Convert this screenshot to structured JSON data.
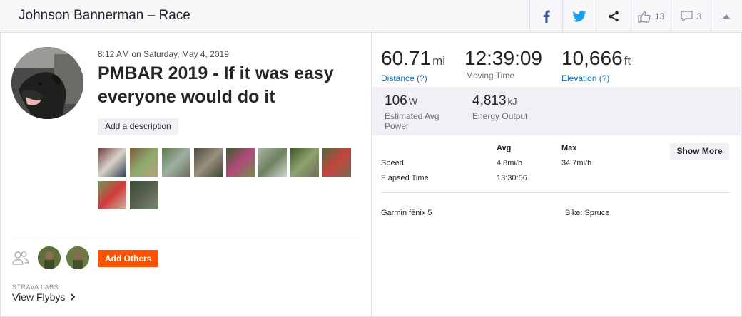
{
  "header": {
    "title": "Johnson Bannerman – Race",
    "kudos_count": "13",
    "comments_count": "3"
  },
  "activity": {
    "date": "8:12 AM on Saturday, May 4, 2019",
    "title": "PMBAR 2019 - If it was easy everyone would do it",
    "add_description": "Add a description"
  },
  "photos": [
    {
      "colors": [
        "#6b3f3a",
        "#d9d4c8",
        "#2f3f56"
      ]
    },
    {
      "colors": [
        "#7a5a3b",
        "#8eab6f",
        "#b6a27c"
      ]
    },
    {
      "colors": [
        "#5d7a4b",
        "#9fb0a4",
        "#6a6b57"
      ]
    },
    {
      "colors": [
        "#4a4b3b",
        "#9b8e80",
        "#3d4a33"
      ]
    },
    {
      "colors": [
        "#3e5b2d",
        "#b24a7a",
        "#6f8f4a"
      ]
    },
    {
      "colors": [
        "#a8b2a2",
        "#6e8262",
        "#cfd6cc"
      ]
    },
    {
      "colors": [
        "#3f5a2c",
        "#8ea26c",
        "#6a6f58"
      ]
    },
    {
      "colors": [
        "#4d6b3a",
        "#c4443c",
        "#7b6a52"
      ]
    },
    {
      "colors": [
        "#6d9a55",
        "#d03a3a",
        "#c8b3a0"
      ]
    },
    {
      "colors": [
        "#3b4a3a",
        "#59614f",
        "#7c8a6e"
      ]
    }
  ],
  "social": {
    "add_others": "Add Others",
    "labs_label": "STRAVA LABS",
    "flybys": "View Flybys"
  },
  "stats": {
    "distance": {
      "value": "60.71",
      "unit": "mi",
      "label": "Distance (?)"
    },
    "moving_time": {
      "value": "12:39:09",
      "label": "Moving Time"
    },
    "elevation": {
      "value": "10,666",
      "unit": "ft",
      "label": "Elevation (?)"
    },
    "power": {
      "value": "106",
      "unit": "W",
      "label": "Estimated Avg Power"
    },
    "energy": {
      "value": "4,813",
      "unit": "kJ",
      "label": "Energy Output"
    }
  },
  "table": {
    "col_avg": "Avg",
    "col_max": "Max",
    "show_more": "Show More",
    "rows": [
      {
        "label": "Speed",
        "avg": "4.8mi/h",
        "max": "34.7mi/h"
      },
      {
        "label": "Elapsed Time",
        "avg": "13:30:56",
        "max": ""
      }
    ]
  },
  "gear": {
    "device": "Garmin fēnix 5",
    "bike": "Bike: Spruce"
  },
  "colors": {
    "brand_orange": "#fc5200",
    "link_blue": "#0a6fb6",
    "facebook": "#3b5998",
    "twitter": "#1da1f2"
  }
}
